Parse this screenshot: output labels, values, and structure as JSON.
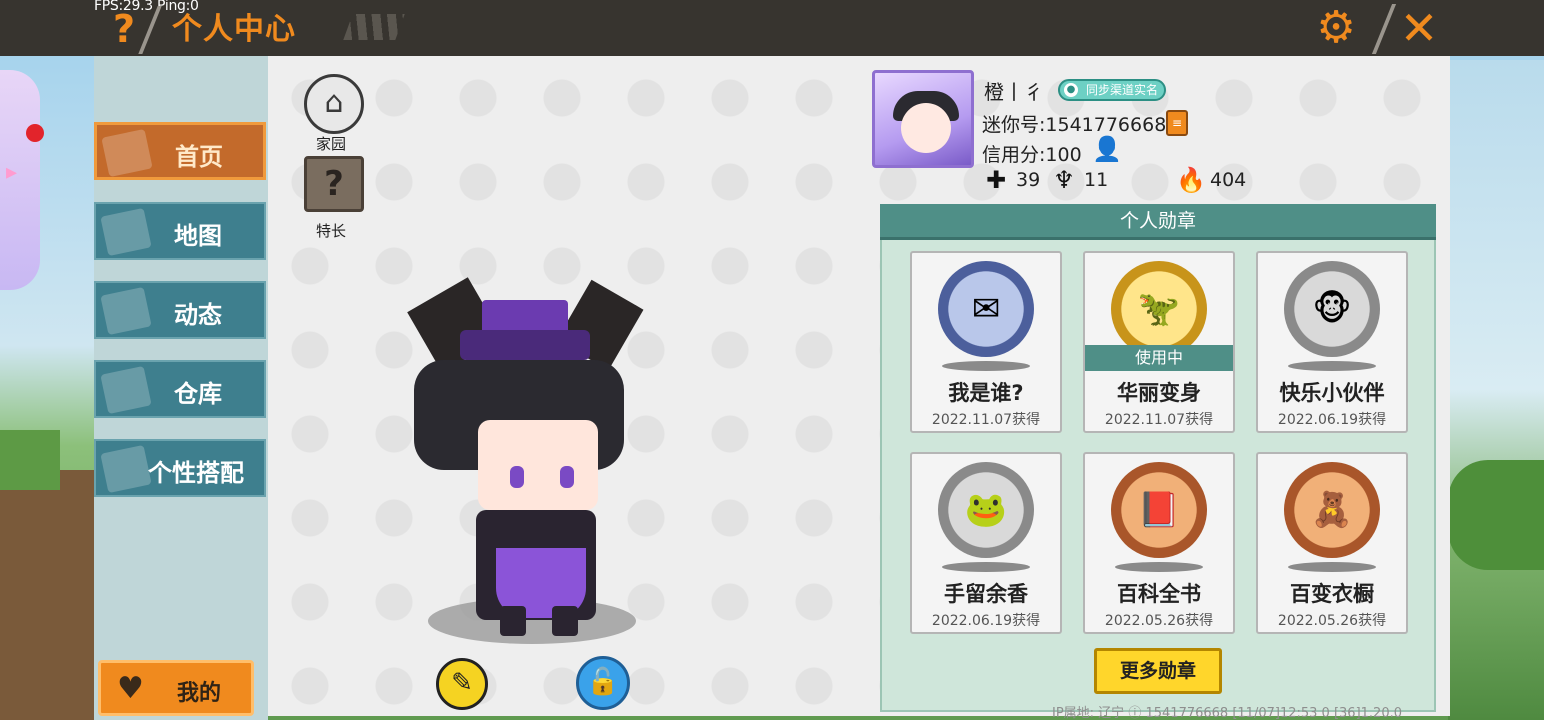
{
  "overlay": {
    "fps": "FPS:29.3",
    "ping": "Ping:0"
  },
  "header": {
    "title": "个人中心",
    "help_icon": "question-mark-icon",
    "settings_icon": "gear-icon",
    "close_icon": "close-x-icon"
  },
  "nav": {
    "items": [
      {
        "label": "首页",
        "icon": "house-icon",
        "active": true
      },
      {
        "label": "地图",
        "icon": "map-icon",
        "active": false
      },
      {
        "label": "动态",
        "icon": "bell-icon",
        "active": false
      },
      {
        "label": "仓库",
        "icon": "box-icon",
        "active": false
      },
      {
        "label": "个性搭配",
        "icon": "wardrobe-icon",
        "active": false
      }
    ],
    "mine_label": "我的"
  },
  "quick": {
    "home_label": "家园",
    "talent_label": "特长"
  },
  "profile": {
    "name": "橙丨彳",
    "sync_label": "同步渠道实名",
    "mini_id": "迷你号:1541776668",
    "credit": "信用分:100",
    "stats": [
      {
        "icon": "bookmark-plus-icon",
        "value": "39"
      },
      {
        "icon": "cheer-icon",
        "value": "11"
      },
      {
        "icon": "flame-icon",
        "value": "404"
      }
    ]
  },
  "badges": {
    "title": "个人勋章",
    "in_use_label": "使用中",
    "items": [
      {
        "name": "我是谁?",
        "date": "2022.11.07获得",
        "medal": "blue",
        "glyph": "✉"
      },
      {
        "name": "华丽变身",
        "date": "2022.11.07获得",
        "medal": "gold",
        "glyph": "🦖",
        "in_use": true
      },
      {
        "name": "快乐小伙伴",
        "date": "2022.06.19获得",
        "medal": "silver",
        "glyph": "🐵"
      },
      {
        "name": "手留余香",
        "date": "2022.06.19获得",
        "medal": "silver",
        "glyph": "🐸"
      },
      {
        "name": "百科全书",
        "date": "2022.05.26获得",
        "medal": "bronze",
        "glyph": "📕"
      },
      {
        "name": "百变衣橱",
        "date": "2022.05.26获得",
        "medal": "bronze",
        "glyph": "🧸"
      }
    ],
    "more_label": "更多勋章"
  },
  "footer": {
    "ip": "IP属地: 辽宁",
    "uid": "1541776668",
    "time": "[11/07]12:53 0",
    "version": "[36]1.20.0"
  },
  "colors": {
    "accent": "#f08a1e",
    "topbar": "#37342f",
    "nav_teal": "#3e7f8e",
    "badge_header": "#4f8f87",
    "more_button": "#ffd62b"
  }
}
